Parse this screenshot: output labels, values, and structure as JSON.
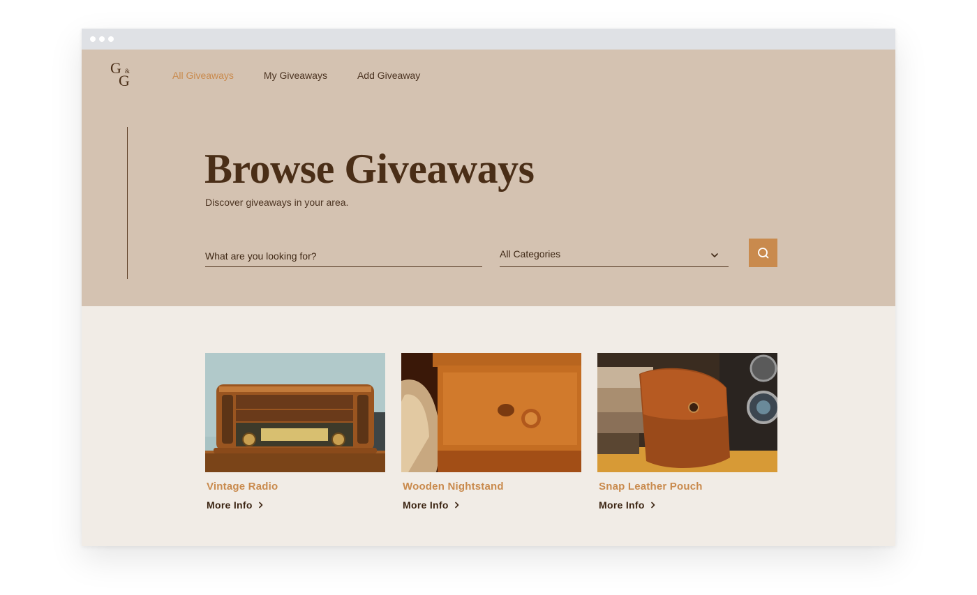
{
  "nav": {
    "logo": {
      "g1": "G",
      "amp": "&",
      "g2": "G"
    },
    "items": [
      {
        "label": "All Giveaways",
        "active": true
      },
      {
        "label": "My Giveaways",
        "active": false
      },
      {
        "label": "Add Giveaway",
        "active": false
      }
    ]
  },
  "hero": {
    "title": "Browse Giveaways",
    "subtitle": "Discover giveaways in your area.",
    "search_placeholder": "What are you looking for?",
    "category_selected": "All Categories"
  },
  "cards": [
    {
      "title": "Vintage Radio",
      "link": "More Info"
    },
    {
      "title": "Wooden Nightstand",
      "link": "More Info"
    },
    {
      "title": "Snap Leather Pouch",
      "link": "More Info"
    }
  ],
  "colors": {
    "hero_bg": "#d4c2b1",
    "page_bg": "#f1ece6",
    "accent": "#c98a4d",
    "dark_brown": "#4a2e17"
  },
  "icons": [
    "window-dot-icon",
    "chevron-down-icon",
    "search-icon",
    "chevron-right-icon"
  ]
}
